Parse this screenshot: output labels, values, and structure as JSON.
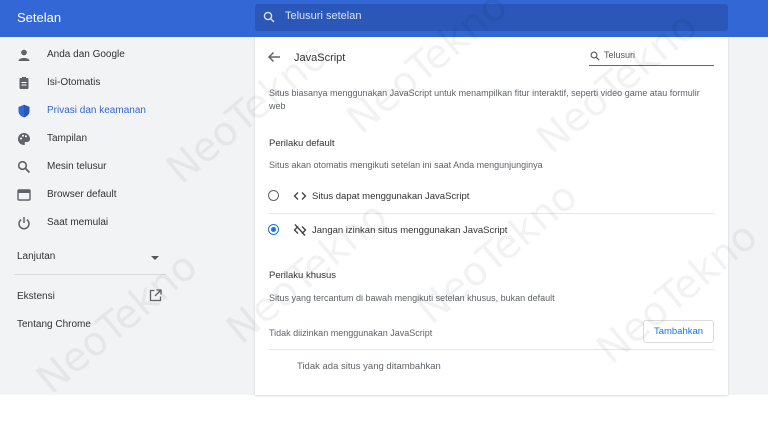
{
  "app": {
    "title": "Setelan"
  },
  "search": {
    "placeholder": "Telusuri setelan"
  },
  "sidebar": {
    "items": [
      {
        "label": "Anda dan Google",
        "icon": "person-icon"
      },
      {
        "label": "Isi-Otomatis",
        "icon": "clipboard-icon"
      },
      {
        "label": "Privasi dan keamanan",
        "icon": "shield-icon",
        "active": true
      },
      {
        "label": "Tampilan",
        "icon": "palette-icon"
      },
      {
        "label": "Mesin telusur",
        "icon": "search-icon"
      },
      {
        "label": "Browser default",
        "icon": "browser-icon"
      },
      {
        "label": "Saat memulai",
        "icon": "power-icon"
      }
    ],
    "advanced": "Lanjutan",
    "extensions": "Ekstensi",
    "about": "Tentang Chrome"
  },
  "page": {
    "title": "JavaScript",
    "search_placeholder": "Telusuri",
    "description": "Situs biasanya menggunakan JavaScript untuk menampilkan fitur interaktif, seperti video game atau formulir web",
    "default_heading": "Perilaku default",
    "default_sub": "Situs akan otomatis mengikuti setelan ini saat Anda mengunjunginya",
    "options": [
      {
        "label": "Situs dapat menggunakan JavaScript",
        "selected": false
      },
      {
        "label": "Jangan izinkan situs menggunakan JavaScript",
        "selected": true
      }
    ],
    "custom_heading": "Perilaku khusus",
    "custom_sub": "Situs yang tercantum di bawah mengikuti setelan khusus, bukan default",
    "not_allowed_label": "Tidak diizinkan menggunakan JavaScript",
    "add_button": "Tambahkan",
    "empty_text": "Tidak ada situs yang ditambahkan"
  },
  "watermark": "NeoTekno",
  "colors": {
    "header": "#3367d6",
    "accent": "#1a73e8",
    "background": "#f1f3f4"
  }
}
